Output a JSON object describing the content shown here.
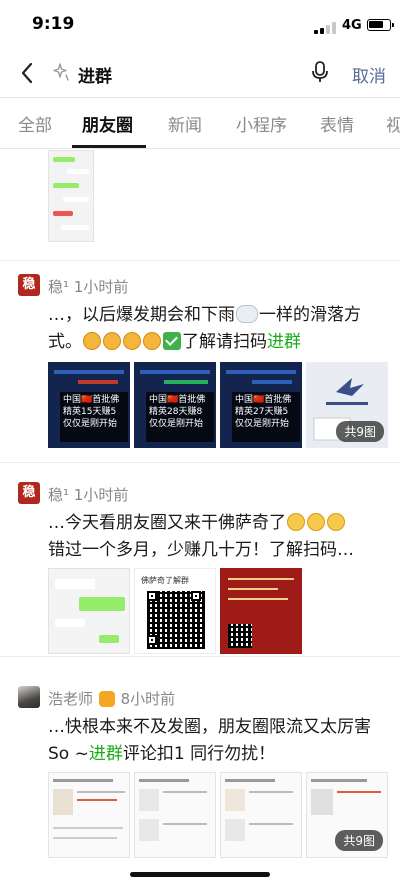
{
  "status_bar": {
    "time": "9:19",
    "network": "4G"
  },
  "search": {
    "query": "进群",
    "cancel_label": "取消"
  },
  "tabs": [
    {
      "label": "全部",
      "active": false
    },
    {
      "label": "朋友圈",
      "active": true
    },
    {
      "label": "新闻",
      "active": false
    },
    {
      "label": "小程序",
      "active": false
    },
    {
      "label": "表情",
      "active": false
    },
    {
      "label": "视",
      "active": false
    }
  ],
  "posts": [
    {
      "author": "稳¹",
      "time": "1小时前",
      "avatar_text": "稳",
      "text_before": "…，以后爆发期会和下雨",
      "text_after": "一样的滑落方式。",
      "text_tail": "了解请扫码",
      "highlight": "进群",
      "image_count_label": "共9图",
      "image_lines": [
        [
          "中国🇨🇳首批佛",
          "精英15天赚5",
          "仅仅是刚开始"
        ],
        [
          "中国🇨🇳首批佛",
          "精英28天赚8",
          "仅仅是刚开始"
        ],
        [
          "中国🇨🇳首批佛",
          "精英27天赚5",
          "仅仅是刚开始"
        ]
      ]
    },
    {
      "author": "稳¹",
      "time": "1小时前",
      "avatar_text": "稳",
      "text_before": "…今天看朋友圈又来干佛萨奇了",
      "text_after": "错过一个多月，少赚几十万！了解扫码…",
      "poster_caption": "佛萨奇了解群"
    },
    {
      "author": "浩老师",
      "time": "8小时前",
      "text_before": "…快根本来不及发圈，朋友圈限流又太厉害So ~",
      "highlight": "进群",
      "text_after": "评论扣1 同行勿扰！",
      "image_count_label": "共9图"
    }
  ],
  "colors": {
    "link": "#576b95",
    "highlight": "#1aad19",
    "poster_red": "#9e1b18",
    "dark_card": "#13254f"
  }
}
